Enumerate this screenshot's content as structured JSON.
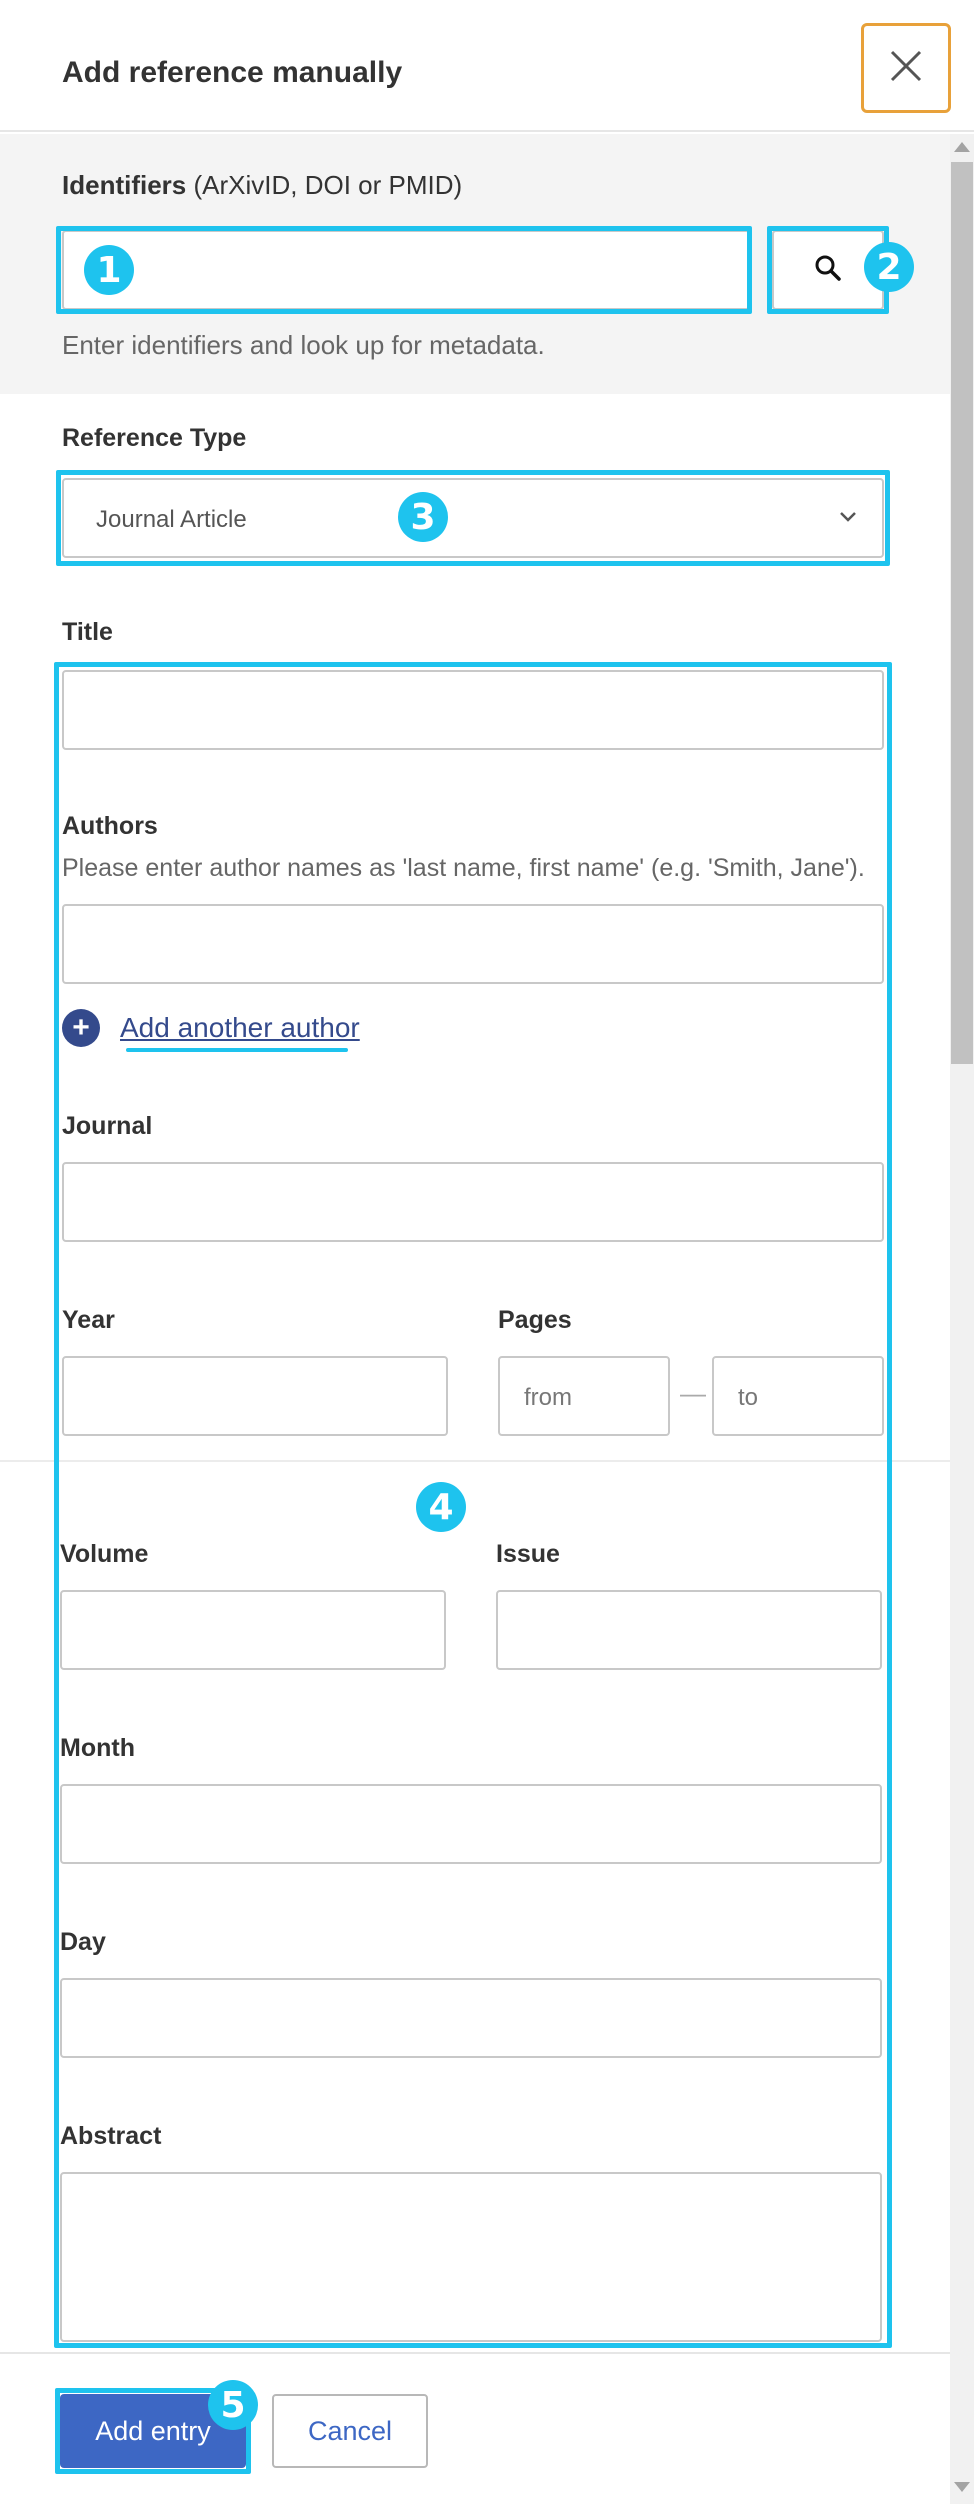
{
  "header": {
    "title": "Add reference manually",
    "close_icon": "close-icon"
  },
  "identifiers": {
    "label_bold": "Identifiers",
    "label_rest": " (ArXivID, DOI or PMID)",
    "value": "",
    "help": "Enter identifiers and look up for metadata.",
    "search_icon": "search-icon"
  },
  "reference_type": {
    "label": "Reference Type",
    "selected": "Journal Article"
  },
  "fields": {
    "title_label": "Title",
    "authors_label": "Authors",
    "authors_hint": "Please enter author names as 'last name, first name' (e.g. 'Smith, Jane').",
    "add_author": "Add another author",
    "add_author_symbol": "+",
    "journal_label": "Journal",
    "year_label": "Year",
    "pages_label": "Pages",
    "pages_from": "from",
    "pages_to": "to",
    "pages_dash": "—",
    "volume_label": "Volume",
    "issue_label": "Issue",
    "month_label": "Month",
    "day_label": "Day",
    "abstract_label": "Abstract"
  },
  "footer": {
    "add_entry": "Add entry",
    "cancel": "Cancel"
  },
  "annotations": {
    "markers": [
      "1",
      "2",
      "3",
      "4",
      "5"
    ],
    "color": "#1ec3ee"
  },
  "colors": {
    "primary": "#3d67c4",
    "close_border": "#e8a13a",
    "add_author_link": "#344a8c"
  }
}
